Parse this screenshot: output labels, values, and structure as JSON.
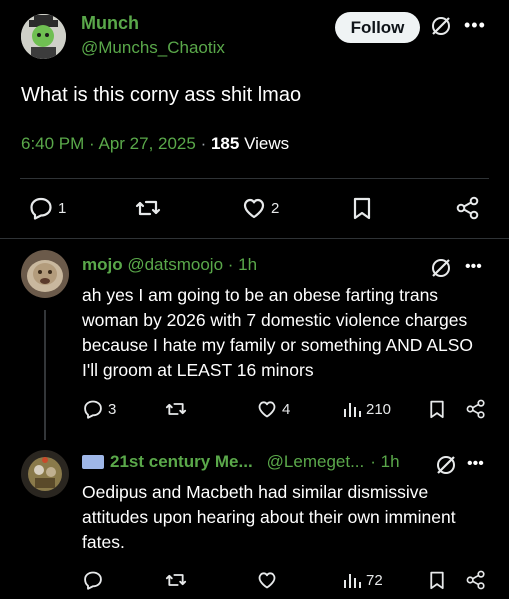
{
  "tweet": {
    "author_name": "Munch",
    "author_handle": "@Munchs_Chaotix",
    "follow_label": "Follow",
    "text": "What is this corny ass shit lmao",
    "time": "6:40 PM",
    "separator": " · ",
    "date": "Apr 27, 2025",
    "views_count": "185",
    "views_label": "Views",
    "actions": {
      "replies": "1",
      "retweets": "",
      "likes": "2"
    }
  },
  "replies": [
    {
      "name": "mojo",
      "handle": "@datsmoojo",
      "time": "· 1h",
      "text": "ah yes I am going to be an obese farting trans woman by 2026 with 7 domestic violence charges because I hate my family or something AND ALSO I'll groom at LEAST 16 minors",
      "replies": "3",
      "retweets": "",
      "likes": "4",
      "views": "210"
    },
    {
      "name": "21st century Me...",
      "handle": "@Lemeget...",
      "time": "· 1h",
      "text": "Oedipus and Macbeth had similar dismissive attitudes upon hearing about their own imminent fates.",
      "replies": "",
      "retweets": "",
      "likes": "",
      "views": "72"
    }
  ],
  "colors": {
    "accent_green": "#5aa84a",
    "muted": "#9aa0a6",
    "follow_bg": "#eff3f4"
  }
}
